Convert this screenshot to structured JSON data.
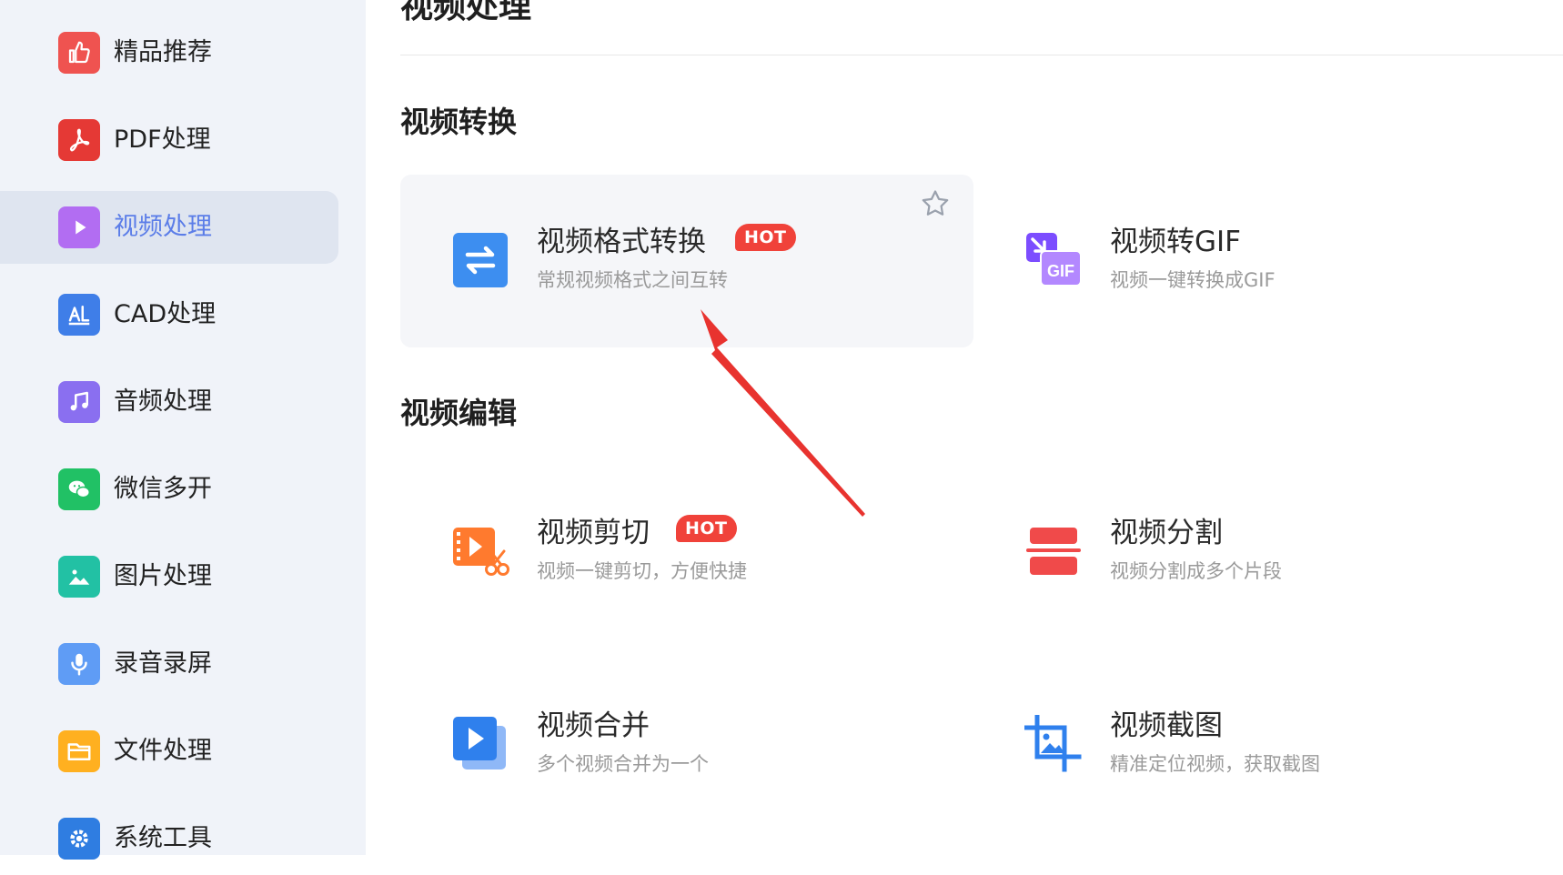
{
  "sidebar": {
    "items": [
      {
        "label": "精品推荐",
        "icon": "thumbs-up-icon",
        "color": "#ef5350",
        "active": false
      },
      {
        "label": "PDF处理",
        "icon": "pdf-icon",
        "color": "#e53935",
        "active": false
      },
      {
        "label": "视频处理",
        "icon": "video-play-icon",
        "color": "#b26df2",
        "active": true
      },
      {
        "label": "CAD处理",
        "icon": "cad-icon",
        "color": "#3f7ee8",
        "active": false
      },
      {
        "label": "音频处理",
        "icon": "music-note-icon",
        "color": "#8a6ff0",
        "active": false
      },
      {
        "label": "微信多开",
        "icon": "wechat-icon",
        "color": "#21c165",
        "active": false
      },
      {
        "label": "图片处理",
        "icon": "image-icon",
        "color": "#22c1a4",
        "active": false
      },
      {
        "label": "录音录屏",
        "icon": "microphone-icon",
        "color": "#5f9cf5",
        "active": false
      },
      {
        "label": "文件处理",
        "icon": "folder-icon",
        "color": "#ffb020",
        "active": false
      },
      {
        "label": "系统工具",
        "icon": "gear-icon",
        "color": "#2f7de1",
        "active": false
      }
    ]
  },
  "main": {
    "title": "视频处理",
    "sections": [
      {
        "title": "视频转换",
        "tools": [
          {
            "name": "视频格式转换",
            "desc": "常规视频格式之间互转",
            "hot": "HOT",
            "icon": "convert-arrows-icon"
          },
          {
            "name": "视频转GIF",
            "desc": "视频一键转换成GIF",
            "icon": "gif-icon",
            "icon_text": "GIF"
          }
        ]
      },
      {
        "title": "视频编辑",
        "tools": [
          {
            "name": "视频剪切",
            "desc": "视频一键剪切，方便快捷",
            "hot": "HOT",
            "icon": "video-cut-icon"
          },
          {
            "name": "视频分割",
            "desc": "视频分割成多个片段",
            "icon": "split-icon"
          },
          {
            "name": "视频合并",
            "desc": "多个视频合并为一个",
            "icon": "video-merge-icon"
          },
          {
            "name": "视频截图",
            "desc": "精准定位视频，获取截图",
            "icon": "crop-screenshot-icon"
          }
        ]
      }
    ]
  },
  "colors": {
    "accent": "#5b7de8",
    "hot_badge": "#f0423a",
    "annotation_arrow": "#e8332f"
  }
}
